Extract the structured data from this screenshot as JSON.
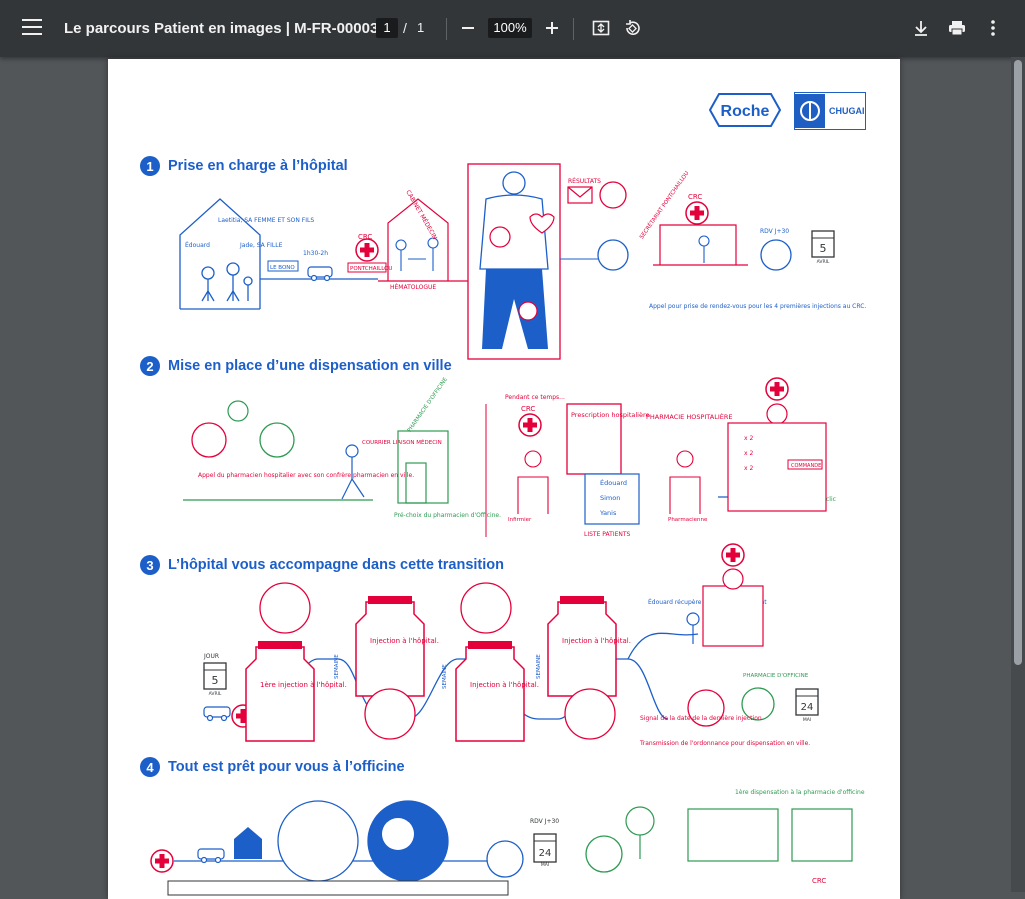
{
  "toolbar": {
    "title": "Le parcours Patient en images | M-FR-00003...",
    "page_current": "1",
    "page_separator": "/",
    "page_total": "1",
    "zoom": "100%"
  },
  "logos": {
    "roche": "Roche",
    "chugai": "CHUGAI"
  },
  "sections": [
    {
      "number": "1",
      "title": "Prise en charge à l’hôpital"
    },
    {
      "number": "2",
      "title": "Mise en place d’une dispensation en ville"
    },
    {
      "number": "3",
      "title": "L’hôpital vous accompagne dans cette transition"
    },
    {
      "number": "4",
      "title": "Tout est prêt pour vous à l’officine"
    }
  ],
  "s1": {
    "family_note": "Laetitia, SA FEMME ET SON FILS",
    "father": "Édouard",
    "daughter": "Jade, SA FILLE",
    "distance": "1h30-2h",
    "le_bono": "LE BONO",
    "crc": "CRC",
    "pontchaillou": "PONTCHAILLOU",
    "cabinet": "CABINET MÉDECIN",
    "hematologue": "HÉMATOLOGUE",
    "resultats": "RÉSULTATS",
    "crc2": "CRC",
    "secretariat": "SECRÉTARIAT PONTCHAILLOU",
    "rdv": "RDV J+30",
    "day": "5",
    "month": "AVRIL",
    "caption": "Appel pour prise de rendez-vous pour les 4 premières injections au CRC."
  },
  "s2": {
    "caption_call": "Appel du pharmacien hospitalier avec son confrère pharmacien en ville.",
    "courrier": "COURRIER LIAISON MÉDECIN",
    "pharmacie_officine": "PHARMACIE D'OFFICINE",
    "pre_choix": "Pré-choix du pharmacien d'Officine.",
    "pendant": "Pendant ce temps...",
    "crc": "CRC",
    "prescription": "Prescription hospitalière",
    "pharmacie_hosp": "PHARMACIE HOSPITALIÈRE",
    "names": [
      "Édouard",
      "Simon",
      "Yanis"
    ],
    "liste": "LISTE PATIENTS",
    "infirmier": "Infirmier",
    "pharmacienne": "Pharmacienne",
    "commande": "COMMANDE",
    "clic": "clic",
    "qty": "x 2"
  },
  "s3": {
    "jour": "JOUR",
    "day": "5",
    "month": "AVRIL",
    "first_injection": "1ère injection à l'hôpital.",
    "injection": "Injection à l'hôpital.",
    "semaine": "SEMAINE",
    "recupere": "Édouard récupère 1 mois de traitement",
    "pharmacie_officine": "PHARMACIE D'OFFICINE",
    "signal": "Signal de la date de la dernière injection",
    "transmission": "Transmission de l'ordonnance pour dispensation en ville.",
    "day2": "24",
    "month2": "MAI"
  },
  "s4": {
    "rdv": "RDV J+30",
    "day": "24",
    "month": "MAI",
    "premiere": "1ère dispensation à la pharmacie d'officine",
    "crc": "CRC"
  },
  "colors": {
    "blue": "#1d5fc9",
    "red": "#e4003a",
    "green": "#2e9a52"
  }
}
